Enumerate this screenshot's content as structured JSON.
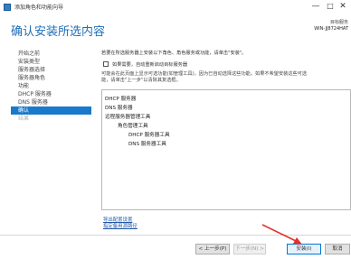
{
  "window": {
    "title": "添加角色和功能向导",
    "controls": {
      "minimize": "—",
      "maximize": "□",
      "close": "✕"
    },
    "icon": "server-manager-icon"
  },
  "header": {
    "page_title": "确认安装所选内容",
    "dest_label": "目标服务",
    "dest_value": "WIN-JJ8724HAT"
  },
  "nav": {
    "items": [
      {
        "label": "开始之前",
        "state": "normal"
      },
      {
        "label": "安装类型",
        "state": "normal"
      },
      {
        "label": "服务器选择",
        "state": "normal"
      },
      {
        "label": "服务器角色",
        "state": "normal"
      },
      {
        "label": "功能",
        "state": "normal"
      },
      {
        "label": "DHCP 服务器",
        "state": "normal"
      },
      {
        "label": "DNS 服务器",
        "state": "normal"
      },
      {
        "label": "确认",
        "state": "active"
      },
      {
        "label": "结果",
        "state": "disabled"
      }
    ]
  },
  "main": {
    "intro": "若要在所选服务器上安装以下角色、角色服务或功能，请单击\"安装\"。",
    "restart_checkbox_label": "如果需要，自动重新启动目标服务器",
    "note_line1": "可能会在此页面上显示可选功能(如管理工具)，因为已自动选择这些功能。如果不希望安装这些可选",
    "note_line2": "能，请单击\"上一步\"以清除其复选框。",
    "features": [
      {
        "label": "DHCP 服务器",
        "indent": 0
      },
      {
        "label": "DNS 服务器",
        "indent": 0
      },
      {
        "label": "远程服务器管理工具",
        "indent": 0
      },
      {
        "label": "角色管理工具",
        "indent": 1
      },
      {
        "label": "DHCP 服务器工具",
        "indent": 2
      },
      {
        "label": "DNS 服务器工具",
        "indent": 2
      }
    ],
    "export_link": "导出配置设置",
    "source_link": "指定备用源路径"
  },
  "footer": {
    "prev": "< 上一步(P)",
    "next": "下一步(N) >",
    "install": "安装(I)",
    "cancel": "取消"
  },
  "colors": {
    "title_blue": "#1f6eb8",
    "nav_active": "#1979ca",
    "link": "#2159a6",
    "annotation_arrow": "#e0322e"
  }
}
